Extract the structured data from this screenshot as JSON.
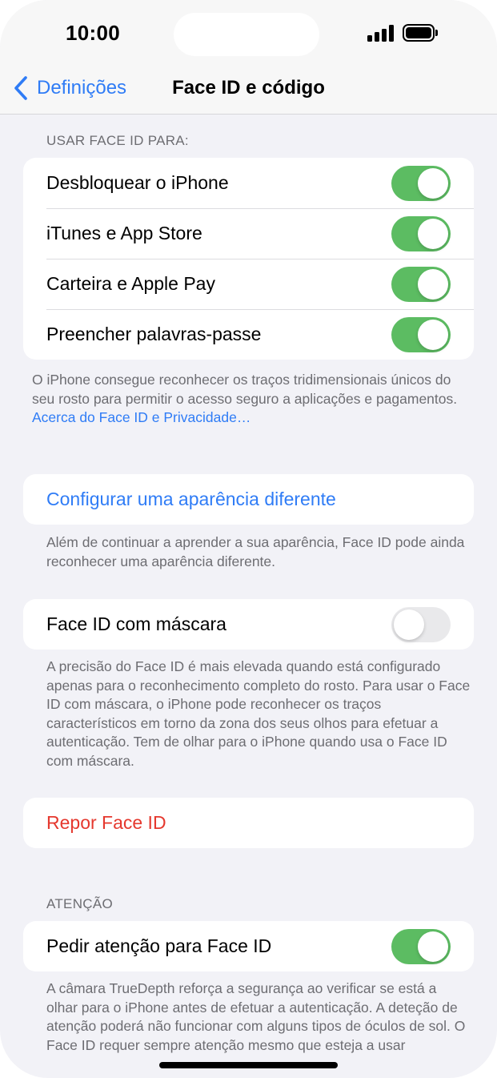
{
  "status_bar": {
    "time": "10:00"
  },
  "nav": {
    "back_label": "Definições",
    "title": "Face ID e código"
  },
  "section_use_face_id": {
    "header": "USAR FACE ID PARA:",
    "items": [
      {
        "label": "Desbloquear o iPhone",
        "enabled": true
      },
      {
        "label": "iTunes e App Store",
        "enabled": true
      },
      {
        "label": "Carteira e Apple Pay",
        "enabled": true
      },
      {
        "label": "Preencher palavras-passe",
        "enabled": true
      }
    ],
    "footer": "O iPhone consegue reconhecer os traços tridimensionais únicos do seu rosto para permitir o acesso seguro a aplicações e pagamentos.",
    "footer_link": "Acerca do Face ID e Privacidade…"
  },
  "alternate_appearance": {
    "label": "Configurar uma aparência diferente",
    "footer": "Além de continuar a aprender a sua aparência, Face ID pode ainda reconhecer uma aparência diferente."
  },
  "mask": {
    "label": "Face ID com máscara",
    "enabled": false,
    "footer": "A precisão do Face ID é mais elevada quando está configurado apenas para o reconhecimento completo do rosto. Para usar o Face ID com máscara, o iPhone pode reconhecer os traços característicos em torno da zona dos seus olhos para efetuar a autenticação. Tem de olhar para o iPhone quando usa o Face ID com máscara."
  },
  "reset": {
    "label": "Repor Face ID"
  },
  "attention": {
    "header": "ATENÇÃO",
    "label": "Pedir atenção para Face ID",
    "enabled": true,
    "footer": "A câmara TrueDepth reforça a segurança ao verificar se está a olhar para o iPhone antes de efetuar a autenticação. A deteção de atenção poderá não funcionar com alguns tipos de óculos de sol. O Face ID requer sempre atenção mesmo que esteja a usar"
  },
  "colors": {
    "accent": "#2f7cf6",
    "destructive": "#e5382e",
    "toggle_on": "#5cbc62",
    "background": "#f2f2f7"
  }
}
